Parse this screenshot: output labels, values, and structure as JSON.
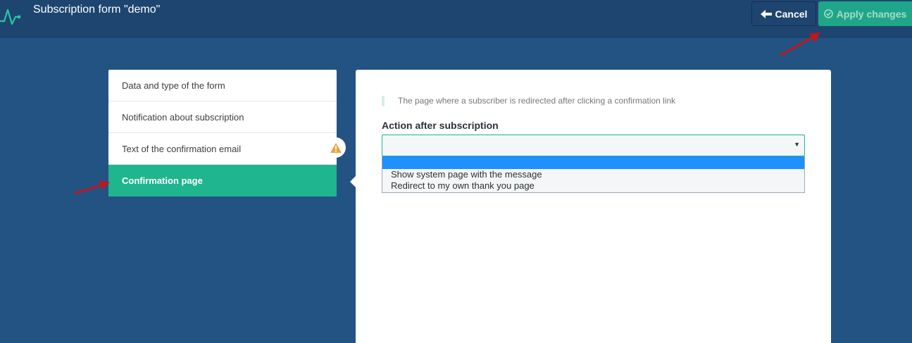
{
  "header": {
    "title": "Subscription form \"demo\"",
    "cancel_label": "Cancel",
    "apply_label": "Apply changes"
  },
  "menu": {
    "items": [
      {
        "label": "Data and type of the form"
      },
      {
        "label": "Notification about subscription"
      },
      {
        "label": "Text of the confirmation email"
      },
      {
        "label": "Confirmation page"
      }
    ],
    "active_index": 3
  },
  "panel": {
    "hint": "The page where a subscriber is redirected after clicking a confirmation link",
    "field_label": "Action after subscription",
    "select_value": "",
    "options": [
      {
        "label": ""
      },
      {
        "label": "Show system page with the message"
      },
      {
        "label": "Redirect to my own thank you page"
      }
    ]
  },
  "colors": {
    "background": "#235383",
    "topbar": "#1e4570",
    "accent": "#1fb58f",
    "warning": "#e8a33d",
    "annotation_arrow": "#c0161c"
  },
  "icons": {
    "logo": "pulse-logo-icon",
    "cancel": "arrow-left-icon",
    "apply": "check-circle-icon",
    "warning": "warning-triangle-icon"
  }
}
